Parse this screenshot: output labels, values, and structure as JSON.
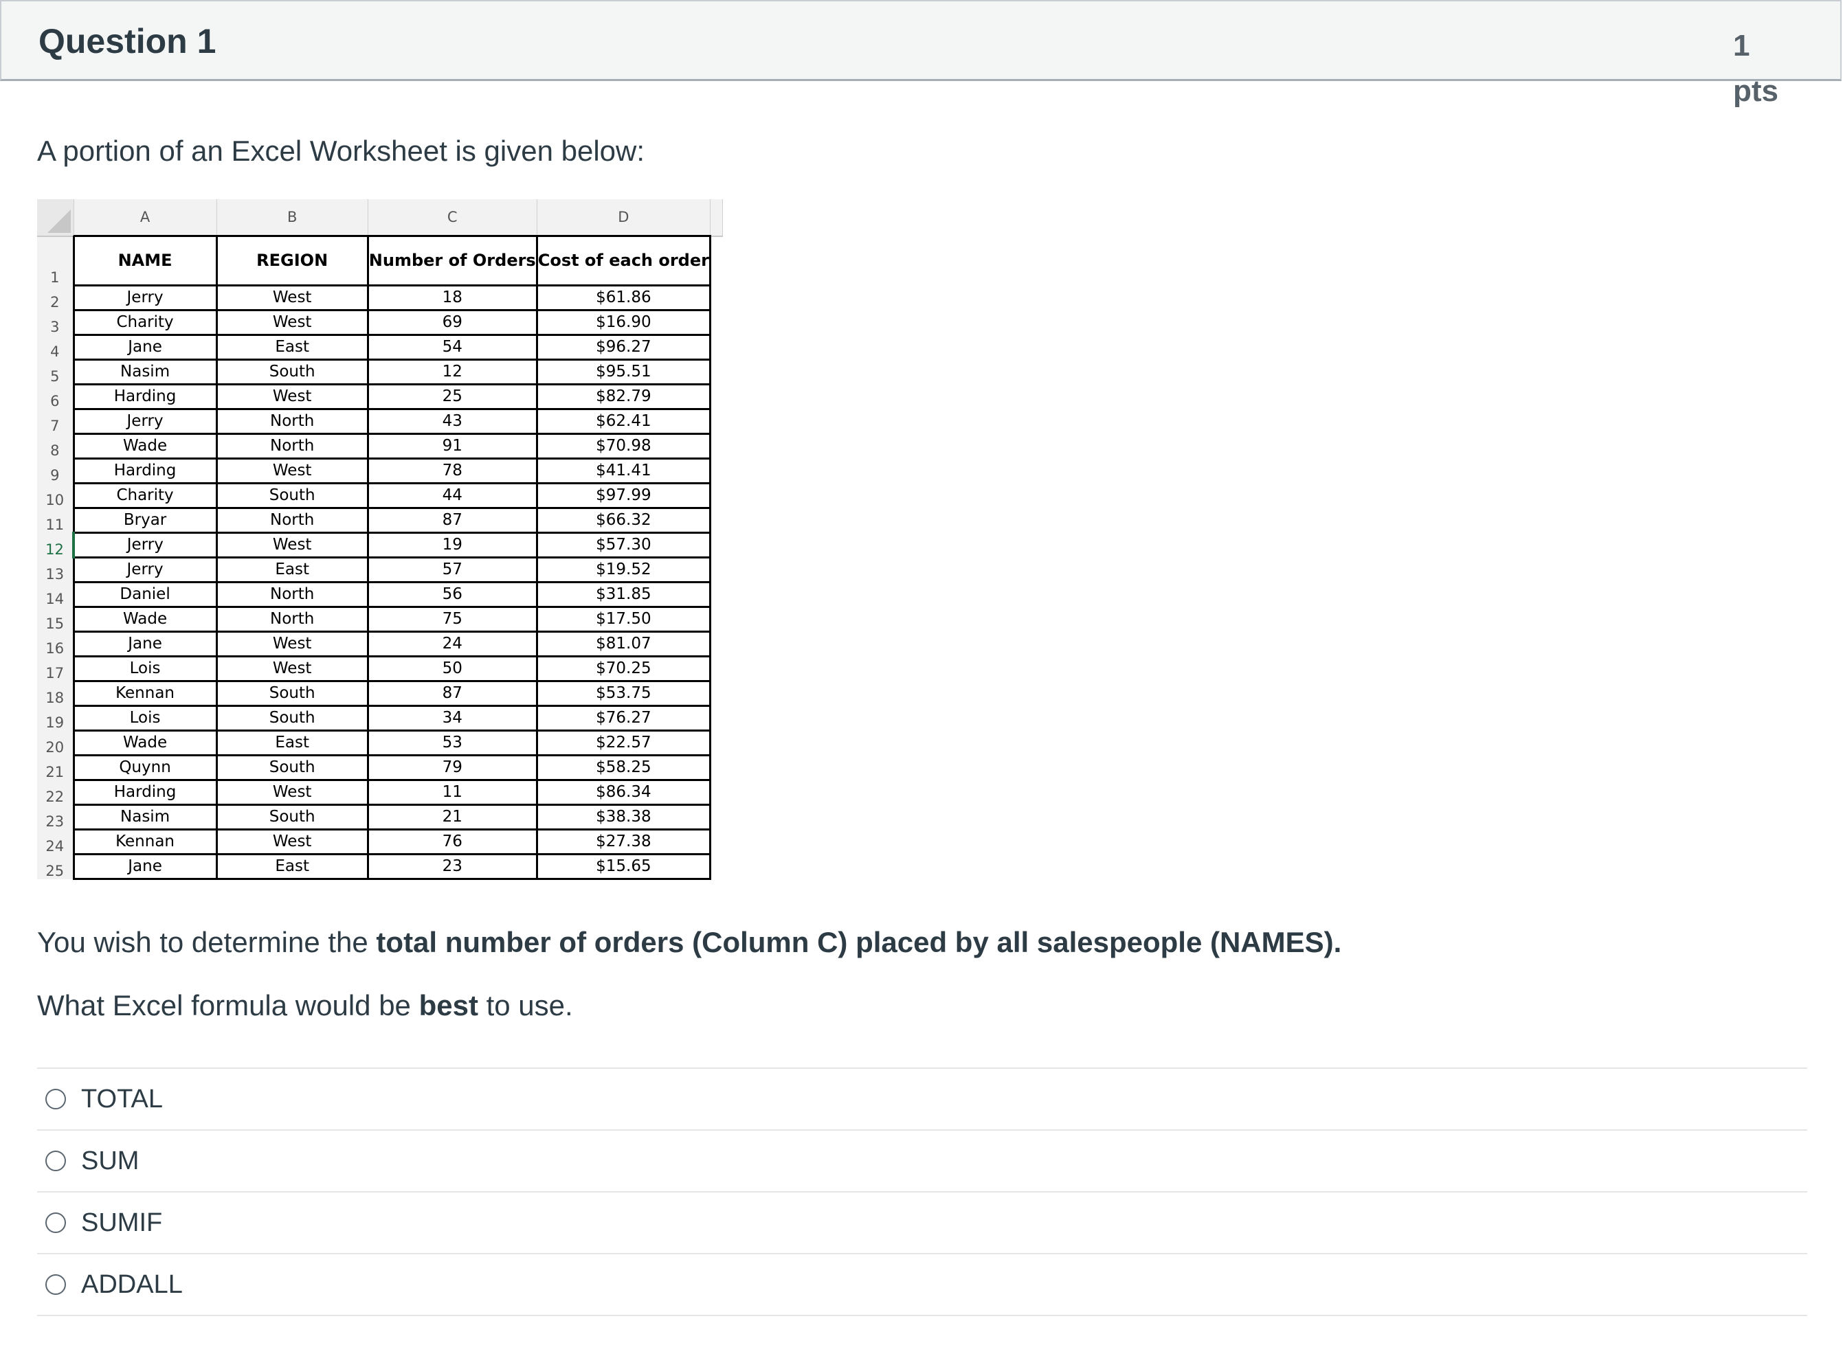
{
  "question": {
    "title": "Question 1",
    "points_value": "1",
    "points_unit": "pts",
    "intro": "A portion of an Excel Worksheet is given below:",
    "prompt_prefix": "You wish to determine the ",
    "prompt_bold": "total number of orders (Column C) placed by all salespeople (NAMES).",
    "ask_prefix": "What Excel formula would be ",
    "ask_bold": "best",
    "ask_suffix": " to use."
  },
  "worksheet": {
    "column_letters": [
      "A",
      "B",
      "C",
      "D"
    ],
    "headers": [
      "NAME",
      "REGION",
      "Number of Orders",
      "Cost of each order"
    ],
    "header_row_number": "1",
    "selected_row": "12",
    "rows": [
      {
        "n": "2",
        "cells": [
          "Jerry",
          "West",
          "18",
          "$61.86"
        ]
      },
      {
        "n": "3",
        "cells": [
          "Charity",
          "West",
          "69",
          "$16.90"
        ]
      },
      {
        "n": "4",
        "cells": [
          "Jane",
          "East",
          "54",
          "$96.27"
        ]
      },
      {
        "n": "5",
        "cells": [
          "Nasim",
          "South",
          "12",
          "$95.51"
        ]
      },
      {
        "n": "6",
        "cells": [
          "Harding",
          "West",
          "25",
          "$82.79"
        ]
      },
      {
        "n": "7",
        "cells": [
          "Jerry",
          "North",
          "43",
          "$62.41"
        ]
      },
      {
        "n": "8",
        "cells": [
          "Wade",
          "North",
          "91",
          "$70.98"
        ]
      },
      {
        "n": "9",
        "cells": [
          "Harding",
          "West",
          "78",
          "$41.41"
        ]
      },
      {
        "n": "10",
        "cells": [
          "Charity",
          "South",
          "44",
          "$97.99"
        ]
      },
      {
        "n": "11",
        "cells": [
          "Bryar",
          "North",
          "87",
          "$66.32"
        ]
      },
      {
        "n": "12",
        "cells": [
          "Jerry",
          "West",
          "19",
          "$57.30"
        ]
      },
      {
        "n": "13",
        "cells": [
          "Jerry",
          "East",
          "57",
          "$19.52"
        ]
      },
      {
        "n": "14",
        "cells": [
          "Daniel",
          "North",
          "56",
          "$31.85"
        ]
      },
      {
        "n": "15",
        "cells": [
          "Wade",
          "North",
          "75",
          "$17.50"
        ]
      },
      {
        "n": "16",
        "cells": [
          "Jane",
          "West",
          "24",
          "$81.07"
        ]
      },
      {
        "n": "17",
        "cells": [
          "Lois",
          "West",
          "50",
          "$70.25"
        ]
      },
      {
        "n": "18",
        "cells": [
          "Kennan",
          "South",
          "87",
          "$53.75"
        ]
      },
      {
        "n": "19",
        "cells": [
          "Lois",
          "South",
          "34",
          "$76.27"
        ]
      },
      {
        "n": "20",
        "cells": [
          "Wade",
          "East",
          "53",
          "$22.57"
        ]
      },
      {
        "n": "21",
        "cells": [
          "Quynn",
          "South",
          "79",
          "$58.25"
        ]
      },
      {
        "n": "22",
        "cells": [
          "Harding",
          "West",
          "11",
          "$86.34"
        ]
      },
      {
        "n": "23",
        "cells": [
          "Nasim",
          "South",
          "21",
          "$38.38"
        ]
      },
      {
        "n": "24",
        "cells": [
          "Kennan",
          "West",
          "76",
          "$27.38"
        ]
      },
      {
        "n": "25",
        "cells": [
          "Jane",
          "East",
          "23",
          "$15.65"
        ]
      }
    ]
  },
  "answers": [
    {
      "label": "TOTAL"
    },
    {
      "label": "SUM"
    },
    {
      "label": "SUMIF"
    },
    {
      "label": "ADDALL"
    }
  ]
}
